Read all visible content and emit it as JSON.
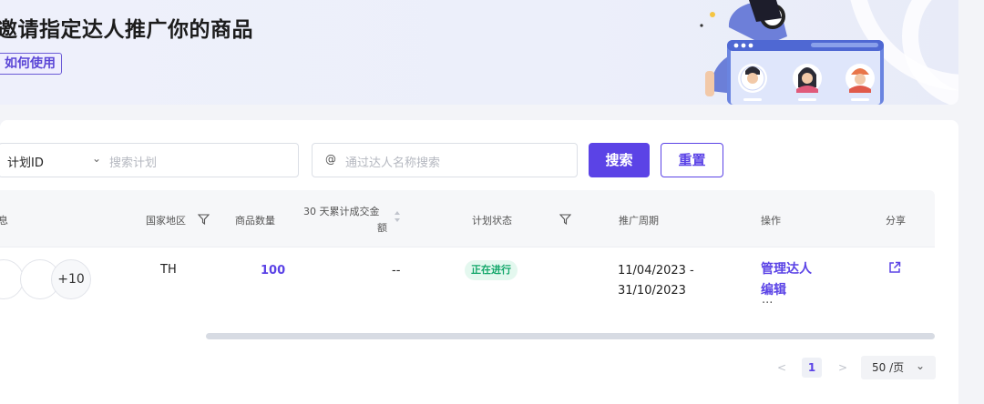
{
  "banner": {
    "title": "邀请指定达人推广你的商品",
    "howto_label": "如何使用"
  },
  "search": {
    "field_select": "计划ID",
    "plan_placeholder": "搜索计划",
    "at_symbol": "@",
    "creator_placeholder": "通过达人名称搜索",
    "search_label": "搜索",
    "reset_label": "重置"
  },
  "table": {
    "headers": {
      "info": "息",
      "region": "国家地区",
      "product_count": "商品数量",
      "gmv_line1": "30 天累计成交金",
      "gmv_line2": "额",
      "status": "计划状态",
      "period": "推广周期",
      "action": "操作",
      "share": "分享"
    },
    "rows": [
      {
        "avatar_more": "+10",
        "region": "TH",
        "product_count": "100",
        "gmv": "--",
        "status": "正在进行",
        "period_start": "11/04/2023 -",
        "period_end": "31/10/2023",
        "action_manage": "管理达人",
        "action_edit": "编辑",
        "action_more": "···"
      }
    ]
  },
  "pagination": {
    "prev": "<",
    "current": "1",
    "next": ">",
    "page_size": "50 /页"
  },
  "colors": {
    "accent": "#5b43e6",
    "status_green": "#13a76a",
    "status_bg": "#e4f8ef"
  }
}
